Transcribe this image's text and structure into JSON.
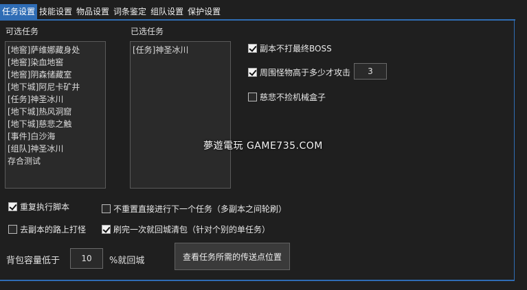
{
  "tabs": [
    {
      "label": "任务设置",
      "active": true
    },
    {
      "label": "技能设置"
    },
    {
      "label": "物品设置"
    },
    {
      "label": "词条鉴定"
    },
    {
      "label": "组队设置"
    },
    {
      "label": "保护设置"
    }
  ],
  "available_tasks": {
    "label": "可选任务",
    "items": [
      "[地窖]萨维娜藏身处",
      "[地窖]染血地窖",
      "[地窖]阴森储藏室",
      "[地下城]阿尼卡矿井",
      "[任务]神圣冰川",
      "[地下城]热风洞窟",
      "[地下城]慈悲之触",
      "[事件]白沙海",
      "[组队]神圣冰川",
      "存合测试"
    ]
  },
  "selected_tasks": {
    "label": "已选任务",
    "items": [
      "[任务]神圣冰川"
    ]
  },
  "options": {
    "skip_final_boss": {
      "label": "副本不打最终BOSS",
      "checked": true
    },
    "attack_when_level_higher": {
      "label": "周围怪物高于多少才攻击",
      "checked": true,
      "value": "3"
    },
    "no_pickup_mech_box": {
      "label": "慈悲不捡机械盒子",
      "checked": false
    },
    "repeat_script": {
      "label": "重复执行脚本",
      "checked": true
    },
    "no_reset_next_task": {
      "label": "不重置直接进行下一个任务（多副本之间轮刷）",
      "checked": false
    },
    "fight_on_way": {
      "label": "去副本的路上打怪",
      "checked": false
    },
    "return_clear_bag": {
      "label": "刷完一次就回城清包（针对个别的单任务）",
      "checked": true
    }
  },
  "bag": {
    "label_before": "背包容量低于",
    "value": "10",
    "label_after": "%就回城"
  },
  "teleport_button": {
    "label": "查看任务所需的传送点位置"
  },
  "watermark": "夢遊電玩 GAME735.COM"
}
